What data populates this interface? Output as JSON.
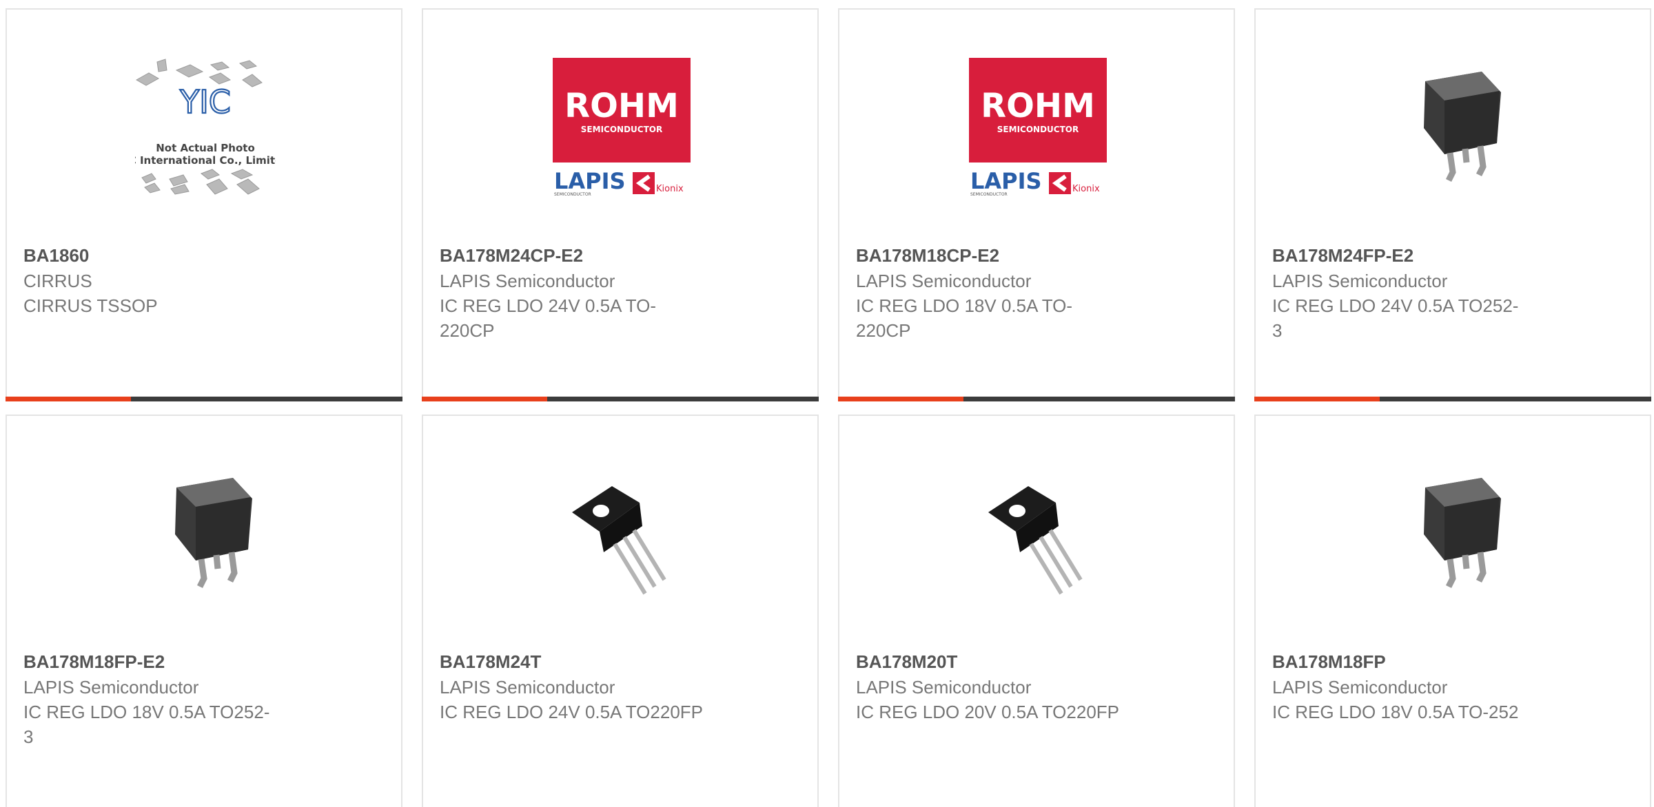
{
  "products": [
    {
      "part": "BA1860",
      "manufacturer": "CIRRUS",
      "description": "CIRRUS TSSOP",
      "image": "yic-placeholder",
      "placeholder_text": [
        "Not Actual Photo",
        "YIC International Co., Limited."
      ]
    },
    {
      "part": "BA178M24CP-E2",
      "manufacturer": "LAPIS Semiconductor",
      "description": "IC REG LDO 24V 0.5A TO-220CP",
      "image": "rohm-logo"
    },
    {
      "part": "BA178M18CP-E2",
      "manufacturer": "LAPIS Semiconductor",
      "description": "IC REG LDO 18V 0.5A TO-220CP",
      "image": "rohm-logo"
    },
    {
      "part": "BA178M24FP-E2",
      "manufacturer": "LAPIS Semiconductor",
      "description": "IC REG LDO 24V 0.5A TO252-3",
      "image": "to252-package"
    },
    {
      "part": "BA178M18FP-E2",
      "manufacturer": "LAPIS Semiconductor",
      "description": "IC REG LDO 18V 0.5A TO252-3",
      "image": "to252-package"
    },
    {
      "part": "BA178M24T",
      "manufacturer": "LAPIS Semiconductor",
      "description": "IC REG LDO 24V 0.5A TO220FP",
      "image": "to220-package"
    },
    {
      "part": "BA178M20T",
      "manufacturer": "LAPIS Semiconductor",
      "description": "IC REG LDO 20V 0.5A TO220FP",
      "image": "to220-package"
    },
    {
      "part": "BA178M18FP",
      "manufacturer": "LAPIS Semiconductor",
      "description": "IC REG LDO 18V 0.5A TO-252",
      "image": "to252-package"
    }
  ],
  "logo_text": {
    "rohm": "ROHM",
    "rohm_sub": "SEMICONDUCTOR",
    "yic": "YIC",
    "lapis": "LAPIS",
    "lapis_sub": "SEMICONDUCTOR",
    "kionix": "Kionix"
  },
  "colors": {
    "accent": "#e8401c",
    "bar": "#3c3c3c",
    "rohm_red": "#d81e3c",
    "lapis_blue": "#2a5ea8"
  }
}
